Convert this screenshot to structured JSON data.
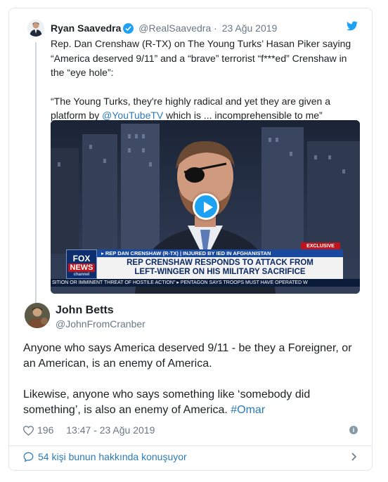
{
  "parent_tweet": {
    "name": "Ryan Saavedra",
    "handle": "@RealSaavedra",
    "separator": "·",
    "date": "23 Ağu 2019",
    "text_lines": [
      "Rep. Dan Crenshaw (R-TX) on The Young Turks’ Hasan Piker saying",
      "“America deserved 9/11” and a “brave” terrorist “f***ed” Crenshaw in",
      "the “eye hole”:"
    ],
    "quote_line1": "“The Young Turks, they're highly radical and yet they are given a",
    "quote_line2_pre": "platform by ",
    "quote_link": "@YouTubeTV",
    "quote_line2_post": " which is ... incomprehensible to me”",
    "media": {
      "exclusive": "EXCLUSIVE",
      "fox_logo_top": "FOX",
      "fox_logo_news": "NEWS",
      "fox_logo_channel": "channel",
      "lower_third_top": "▸ REP DAN CRENSHAW (R-TX) | INJURED BY IED IN AFGHANISTAN",
      "lower_third_line1": "REP CRENSHAW RESPONDS TO ATTACK FROM",
      "lower_third_line2": "LEFT-WINGER ON HIS MILITARY SACRIFICE",
      "ticker": "SITION OR IMMINENT THREAT OF HOSTILE ACTION\" ▸ PENTAGON SAYS TROOPS MUST HAVE OPERATED W"
    }
  },
  "main_tweet": {
    "name": "John Betts",
    "handle": "@JohnFromCranber",
    "para1": "Anyone who says America deserved 9/11 - be they a Foreigner, or an American, is an enemy of America.",
    "para2_pre": "Likewise, anyone who says something like ‘somebody did something’, is also an enemy of America. ",
    "hashtag": "#Omar",
    "likes": "196",
    "timestamp": "13:47 - 23 Ağu 2019",
    "info": "i"
  },
  "footer": {
    "label": "54 kişi bunun hakkında konuşuyor"
  },
  "colors": {
    "link": "#2b7bb9",
    "twitter_blue": "#1da1f2",
    "muted": "#697882",
    "border": "#e1e8ed"
  },
  "icons": [
    "verified-badge-icon",
    "twitter-bird-icon",
    "play-icon",
    "heart-icon",
    "info-icon",
    "speech-bubble-icon",
    "chevron-right-icon"
  ]
}
